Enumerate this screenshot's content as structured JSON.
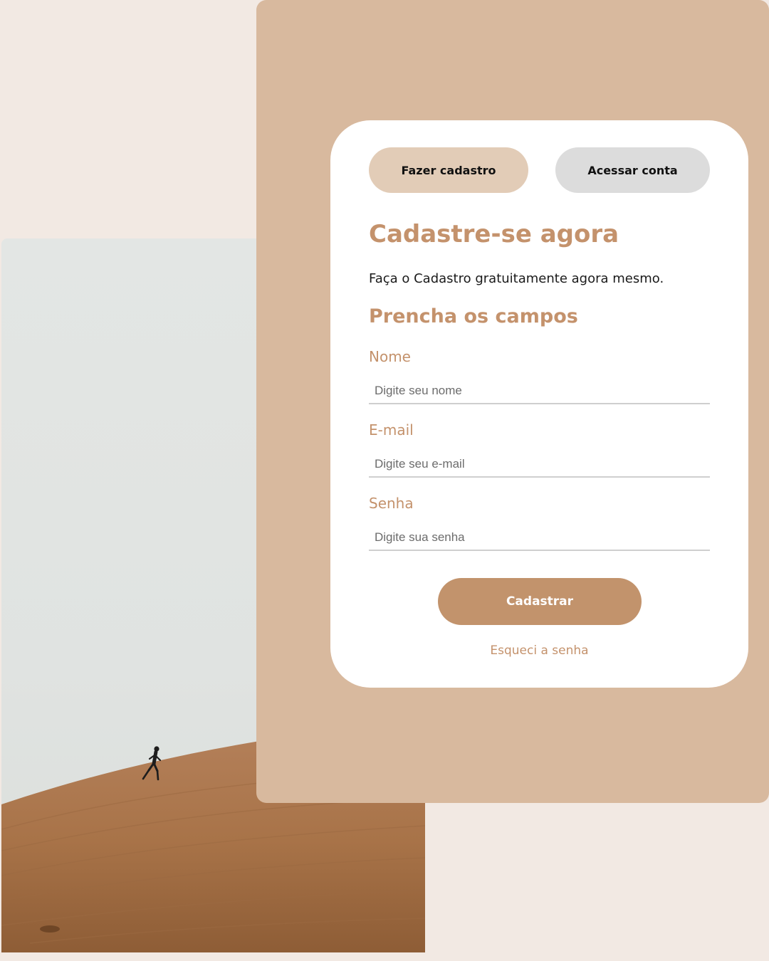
{
  "tabs": {
    "signup_label": "Fazer cadastro",
    "login_label": "Acessar conta"
  },
  "heading": "Cadastre-se agora",
  "subtitle": "Faça o Cadastro gratuitamente agora mesmo.",
  "section_title": "Prencha os campos",
  "fields": [
    {
      "label": "Nome",
      "placeholder": "Digite seu nome",
      "value": ""
    },
    {
      "label": "E-mail",
      "placeholder": "Digite seu e-mail",
      "value": ""
    },
    {
      "label": "Senha",
      "placeholder": "Digite sua senha",
      "value": ""
    }
  ],
  "submit_label": "Cadastrar",
  "forgot_label": "Esqueci a senha",
  "colors": {
    "page_bg": "#f2e9e3",
    "panel_bg": "#d8b99e",
    "accent": "#c4926c",
    "signup_tab_bg": "#e2ccb7",
    "login_tab_bg": "#dcdcdc",
    "card_bg": "#ffffff"
  }
}
